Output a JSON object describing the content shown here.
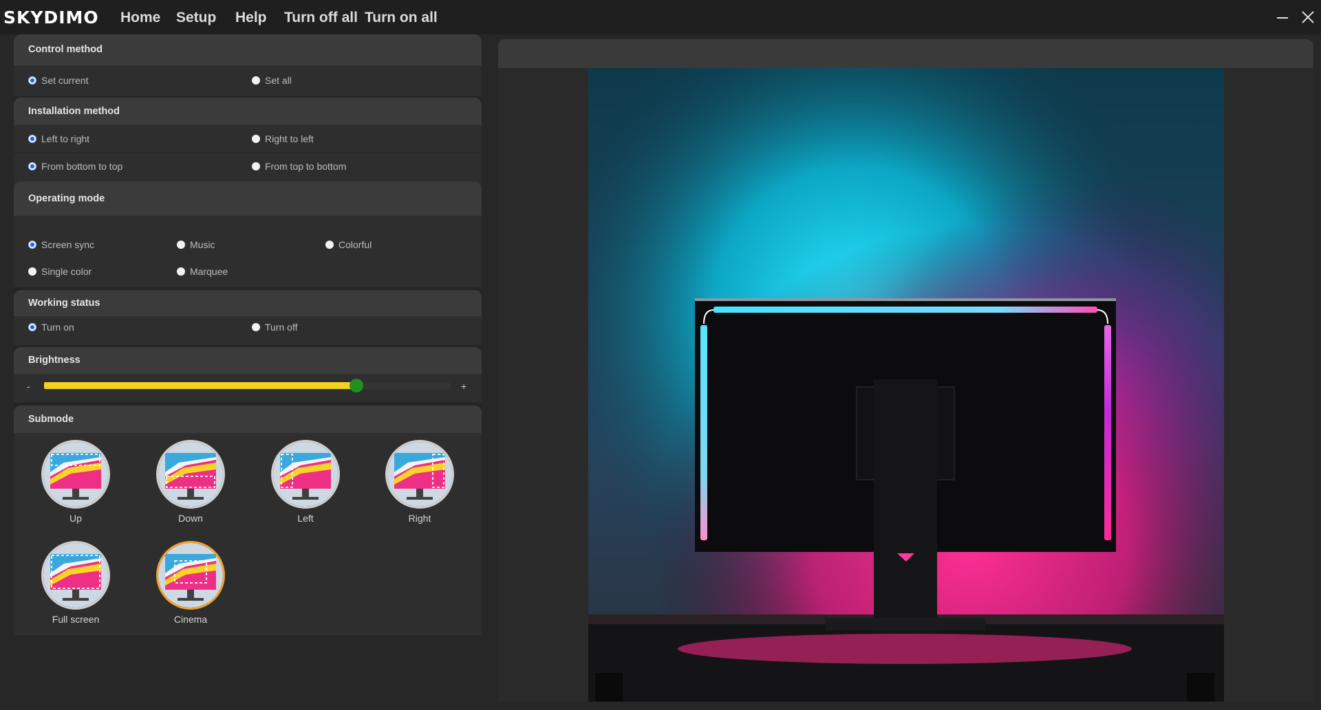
{
  "app": {
    "logo": "SKYDIMO",
    "nav": [
      "Home",
      "Setup",
      "Help",
      "Turn off all",
      "Turn on all"
    ]
  },
  "window": {
    "minimize_icon": "minimize-icon",
    "close_icon": "close-icon"
  },
  "control_method": {
    "title": "Control method",
    "options": [
      {
        "label": "Set current",
        "checked": true
      },
      {
        "label": "Set all",
        "checked": false
      }
    ]
  },
  "installation_method": {
    "title": "Installation method",
    "horizontal": [
      {
        "label": "Left to right",
        "checked": true
      },
      {
        "label": "Right to left",
        "checked": false
      }
    ],
    "vertical": [
      {
        "label": "From bottom to top",
        "checked": true
      },
      {
        "label": "From top to bottom",
        "checked": false
      }
    ]
  },
  "operating_mode": {
    "title": "Operating mode",
    "options": [
      {
        "label": "Screen sync",
        "checked": true
      },
      {
        "label": "Music",
        "checked": false
      },
      {
        "label": "Colorful",
        "checked": false
      },
      {
        "label": "Single color",
        "checked": false
      },
      {
        "label": "Marquee",
        "checked": false
      }
    ]
  },
  "working_status": {
    "title": "Working status",
    "options": [
      {
        "label": "Turn on",
        "checked": true
      },
      {
        "label": "Turn off",
        "checked": false
      }
    ]
  },
  "brightness": {
    "title": "Brightness",
    "minus": "-",
    "plus": "+",
    "value_fraction": 0.77,
    "fill_color": "#f4d11e",
    "thumb_color": "#1f8f1f"
  },
  "submode": {
    "title": "Submode",
    "items": [
      {
        "label": "Up",
        "active": false
      },
      {
        "label": "Down",
        "active": false
      },
      {
        "label": "Left",
        "active": false
      },
      {
        "label": "Right",
        "active": false
      },
      {
        "label": "Full screen",
        "active": false
      },
      {
        "label": "Cinema",
        "active": true
      }
    ]
  },
  "colors": {
    "accent_radio": "#1565e0",
    "active_submode_border": "#f0a22c",
    "glow_cyan": "#14d8f5",
    "glow_magenta": "#f0187c",
    "glow_purple": "#b23ce0"
  }
}
